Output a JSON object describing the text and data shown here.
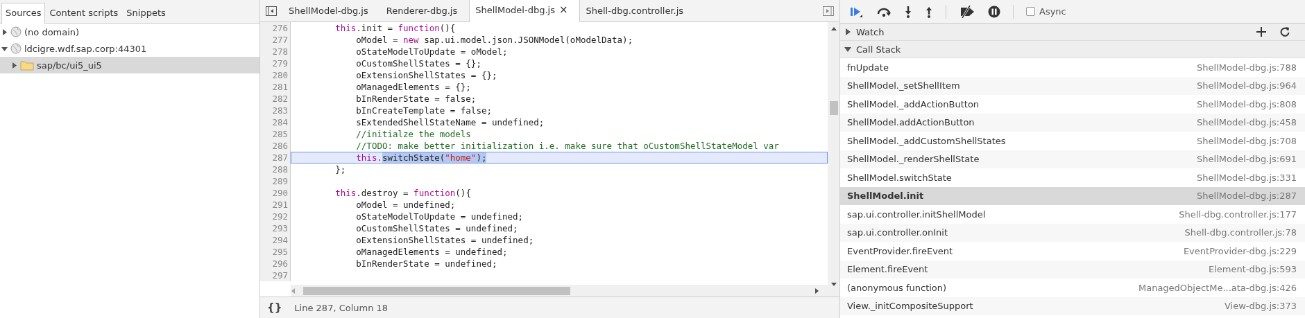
{
  "navigator": {
    "tabs": [
      {
        "label": "Sources",
        "selected": true
      },
      {
        "label": "Content scripts",
        "selected": false
      },
      {
        "label": "Snippets",
        "selected": false
      }
    ],
    "tree": [
      {
        "label": "(no domain)",
        "kind": "domain",
        "expanded": false,
        "selected": false
      },
      {
        "label": "ldcigre.wdf.sap.corp:44301",
        "kind": "domain",
        "expanded": true,
        "selected": false,
        "children": [
          {
            "label": "sap/bc/ui5_ui5",
            "kind": "folder",
            "expanded": false,
            "selected": true
          }
        ]
      }
    ]
  },
  "editor": {
    "tabs": [
      {
        "label": "ShellModel-dbg.js",
        "selected": false
      },
      {
        "label": "Renderer-dbg.js",
        "selected": false
      },
      {
        "label": "ShellModel-dbg.js",
        "selected": true,
        "close": "×"
      },
      {
        "label": "Shell-dbg.controller.js",
        "selected": false
      }
    ],
    "lines": [
      {
        "number": "276",
        "current": false,
        "tokens": [
          {
            "text": "        this",
            "kind": "keyword"
          },
          {
            "text": ".init = ",
            "kind": "plain"
          },
          {
            "text": "function",
            "kind": "keyword"
          },
          {
            "text": "(){",
            "kind": "plain"
          }
        ]
      },
      {
        "number": "277",
        "current": false,
        "tokens": [
          {
            "text": "            oModel = ",
            "kind": "plain"
          },
          {
            "text": "new",
            "kind": "keyword"
          },
          {
            "text": " sap.ui.model.json.JSONModel(oModelData);",
            "kind": "plain"
          }
        ]
      },
      {
        "number": "278",
        "current": false,
        "tokens": [
          {
            "text": "            oStateModelToUpdate = oModel;",
            "kind": "plain"
          }
        ]
      },
      {
        "number": "279",
        "current": false,
        "tokens": [
          {
            "text": "            oCustomShellStates = {};",
            "kind": "plain"
          }
        ]
      },
      {
        "number": "280",
        "current": false,
        "tokens": [
          {
            "text": "            oExtensionShellStates = {};",
            "kind": "plain"
          }
        ]
      },
      {
        "number": "281",
        "current": false,
        "tokens": [
          {
            "text": "            oManagedElements = {};",
            "kind": "plain"
          }
        ]
      },
      {
        "number": "282",
        "current": false,
        "tokens": [
          {
            "text": "            bInRenderState = false;",
            "kind": "plain"
          }
        ]
      },
      {
        "number": "283",
        "current": false,
        "tokens": [
          {
            "text": "            bInCreateTemplate = false;",
            "kind": "plain"
          }
        ]
      },
      {
        "number": "284",
        "current": false,
        "tokens": [
          {
            "text": "            sExtendedShellStateName = undefined;",
            "kind": "plain"
          }
        ]
      },
      {
        "number": "285",
        "current": false,
        "tokens": [
          {
            "text": "            //initialze the models",
            "kind": "comment"
          }
        ]
      },
      {
        "number": "286",
        "current": false,
        "tokens": [
          {
            "text": "            //TODO: make better initialization i.e. make sure that oCustomShellStateModel var",
            "kind": "comment"
          }
        ]
      },
      {
        "number": "287",
        "current": true,
        "tokens": [
          {
            "text": "            this.",
            "kind": "keyword",
            "selected": false
          },
          {
            "text": "switchState(",
            "kind": "plain",
            "selected": true
          },
          {
            "text": "\"home\"",
            "kind": "string",
            "selected": true
          },
          {
            "text": ");",
            "kind": "plain",
            "selected": true
          }
        ]
      },
      {
        "number": "288",
        "current": false,
        "tokens": [
          {
            "text": "        };",
            "kind": "plain"
          }
        ]
      },
      {
        "number": "289",
        "current": false
      },
      {
        "number": "290",
        "current": false,
        "tokens": [
          {
            "text": "        this",
            "kind": "keyword"
          },
          {
            "text": ".destroy = ",
            "kind": "plain"
          },
          {
            "text": "function",
            "kind": "keyword"
          },
          {
            "text": "(){",
            "kind": "plain"
          }
        ]
      },
      {
        "number": "291",
        "current": false,
        "tokens": [
          {
            "text": "            oModel = undefined;",
            "kind": "plain"
          }
        ]
      },
      {
        "number": "292",
        "current": false,
        "tokens": [
          {
            "text": "            oStateModelToUpdate = undefined;",
            "kind": "plain"
          }
        ]
      },
      {
        "number": "293",
        "current": false,
        "tokens": [
          {
            "text": "            oCustomShellStates = undefined;",
            "kind": "plain"
          }
        ]
      },
      {
        "number": "294",
        "current": false,
        "tokens": [
          {
            "text": "            oExtensionShellStates = undefined;",
            "kind": "plain"
          }
        ]
      },
      {
        "number": "295",
        "current": false,
        "tokens": [
          {
            "text": "            oManagedElements = undefined;",
            "kind": "plain"
          }
        ]
      },
      {
        "number": "296",
        "current": false,
        "tokens": [
          {
            "text": "            bInRenderState = undefined;",
            "kind": "plain"
          }
        ]
      },
      {
        "number": "297",
        "current": false
      }
    ],
    "status_bar": {
      "format_button": "{}",
      "position": "Line 287, Column 18"
    }
  },
  "debugger": {
    "async": {
      "label": "Async",
      "checked": false
    },
    "sections": [
      {
        "title": "Watch",
        "expanded": false
      },
      {
        "title": "Call Stack",
        "expanded": true
      }
    ],
    "call_stack": [
      {
        "function": "fnUpdate",
        "location": "ShellModel-dbg.js:788",
        "selected": false
      },
      {
        "function": "ShellModel._setShellItem",
        "location": "ShellModel-dbg.js:964",
        "selected": false
      },
      {
        "function": "ShellModel._addActionButton",
        "location": "ShellModel-dbg.js:808",
        "selected": false
      },
      {
        "function": "ShellModel.addActionButton",
        "location": "ShellModel-dbg.js:458",
        "selected": false
      },
      {
        "function": "ShellModel._addCustomShellStates",
        "location": "ShellModel-dbg.js:708",
        "selected": false
      },
      {
        "function": "ShellModel._renderShellState",
        "location": "ShellModel-dbg.js:691",
        "selected": false
      },
      {
        "function": "ShellModel.switchState",
        "location": "ShellModel-dbg.js:331",
        "selected": false
      },
      {
        "function": "ShellModel.init",
        "location": "ShellModel-dbg.js:287",
        "selected": true
      },
      {
        "function": "sap.ui.controller.initShellModel",
        "location": "Shell-dbg.controller.js:177",
        "selected": false
      },
      {
        "function": "sap.ui.controller.onInit",
        "location": "Shell-dbg.controller.js:78",
        "selected": false
      },
      {
        "function": "EventProvider.fireEvent",
        "location": "EventProvider-dbg.js:229",
        "selected": false
      },
      {
        "function": "Element.fireEvent",
        "location": "Element-dbg.js:593",
        "selected": false
      },
      {
        "function": "(anonymous function)",
        "location": "ManagedObjectMe...ata-dbg.js:426",
        "selected": false
      },
      {
        "function": "View._initCompositeSupport",
        "location": "View-dbg.js:373",
        "selected": false
      }
    ]
  }
}
